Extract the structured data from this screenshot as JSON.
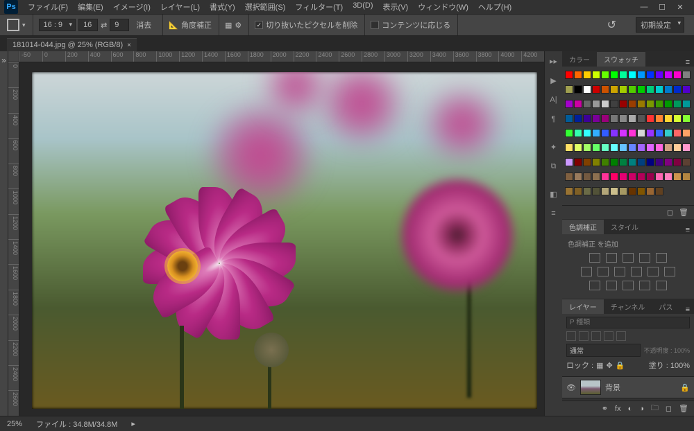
{
  "app": {
    "logo": "Ps"
  },
  "menu": {
    "file": "ファイル(F)",
    "edit": "編集(E)",
    "image": "イメージ(I)",
    "layer": "レイヤー(L)",
    "type": "書式(Y)",
    "select": "選択範囲(S)",
    "filter": "フィルター(T)",
    "threed": "3D(D)",
    "view": "表示(V)",
    "window": "ウィンドウ(W)",
    "help": "ヘルプ(H)"
  },
  "options": {
    "ratio": "16 : 9",
    "w": "16",
    "h": "9",
    "erase": "消去",
    "straighten": "角度補正",
    "chk1_label": "切り抜いたピクセルを削除",
    "chk2_label": "コンテンツに応じる",
    "workspace": "初期設定"
  },
  "doc": {
    "tab": "181014-044.jpg @ 25% (RGB/8)"
  },
  "ruler_h": [
    "-50",
    "0",
    "200",
    "400",
    "600",
    "800",
    "1000",
    "1200",
    "1400",
    "1600",
    "1800",
    "2000",
    "2200",
    "2400",
    "2600",
    "2800",
    "3000",
    "3200",
    "3400",
    "3600",
    "3800",
    "4000",
    "4200"
  ],
  "ruler_v": [
    "0",
    "200",
    "400",
    "600",
    "800",
    "1000",
    "1200",
    "1400",
    "1600",
    "1800",
    "2000",
    "2200",
    "2400",
    "2600"
  ],
  "panels": {
    "color_tab": "カラー",
    "swatch_tab": "スウォッチ",
    "adjustments_tab": "色調補正",
    "styles_tab": "スタイル",
    "adj_label": "色調補正 を追加",
    "layers_tab": "レイヤー",
    "channels_tab": "チャンネル",
    "paths_tab": "パス",
    "search_placeholder": "P 種類",
    "blend_mode": "通常",
    "opacity_label": "不透明度 : 100%",
    "lock_label": "ロック :",
    "fill_label": "塗り : 100%",
    "layer_name": "背景"
  },
  "swatches": [
    "#ff0000",
    "#ff6600",
    "#ffcc00",
    "#ccff00",
    "#66ff00",
    "#00ff00",
    "#00ff99",
    "#00ffff",
    "#0099ff",
    "#0033ff",
    "#6600ff",
    "#cc00ff",
    "#ff00cc",
    "#808080",
    "#a0a050",
    "#000000",
    "#ffffff",
    "#cc0000",
    "#cc5200",
    "#cca300",
    "#a3cc00",
    "#52cc00",
    "#00cc00",
    "#00cc7a",
    "#00cccc",
    "#007acc",
    "#0029cc",
    "#5200cc",
    "#a300cc",
    "#cc00a3",
    "#666666",
    "#999999",
    "#cccccc",
    "#404040",
    "#990000",
    "#993d00",
    "#997a00",
    "#7a9900",
    "#3d9900",
    "#009900",
    "#00995c",
    "#009999",
    "#005c99",
    "#001f99",
    "#3d0099",
    "#7a0099",
    "#99007a",
    "#777777",
    "#888888",
    "#aaaaaa",
    "#555555",
    "#ff3333",
    "#ff8533",
    "#ffd633",
    "#d6ff33",
    "#85ff33",
    "#33ff33",
    "#33ffad",
    "#33ffff",
    "#33adff",
    "#335cff",
    "#8533ff",
    "#d633ff",
    "#ff33d6",
    "#d6d6d6",
    "#9933ff",
    "#3366ff",
    "#33cccc",
    "#ff6666",
    "#ffa366",
    "#ffe066",
    "#e0ff66",
    "#a3ff66",
    "#66ff66",
    "#66ffc2",
    "#66ffff",
    "#66c2ff",
    "#6685ff",
    "#a366ff",
    "#e066ff",
    "#ff66e0",
    "#d0a080",
    "#ffcc99",
    "#ff99cc",
    "#cc99ff",
    "#800000",
    "#804000",
    "#808000",
    "#408000",
    "#008000",
    "#008040",
    "#008080",
    "#004080",
    "#000080",
    "#400080",
    "#800080",
    "#800040",
    "#5c4033",
    "#806040",
    "#997a5c",
    "#735940",
    "#8c7050",
    "#ff3399",
    "#ff0066",
    "#e60073",
    "#cc0066",
    "#b30059",
    "#99004d",
    "#ff66b3",
    "#ff80bf",
    "#cc944d",
    "#b38640",
    "#997333",
    "#806026",
    "#6b6b47",
    "#525238",
    "#b3a679",
    "#ccbf8c",
    "#a69963",
    "#663300",
    "#805500",
    "#996633",
    "#604020"
  ],
  "status": {
    "zoom": "25%",
    "filesize": "ファイル : 34.8M/34.8M"
  }
}
